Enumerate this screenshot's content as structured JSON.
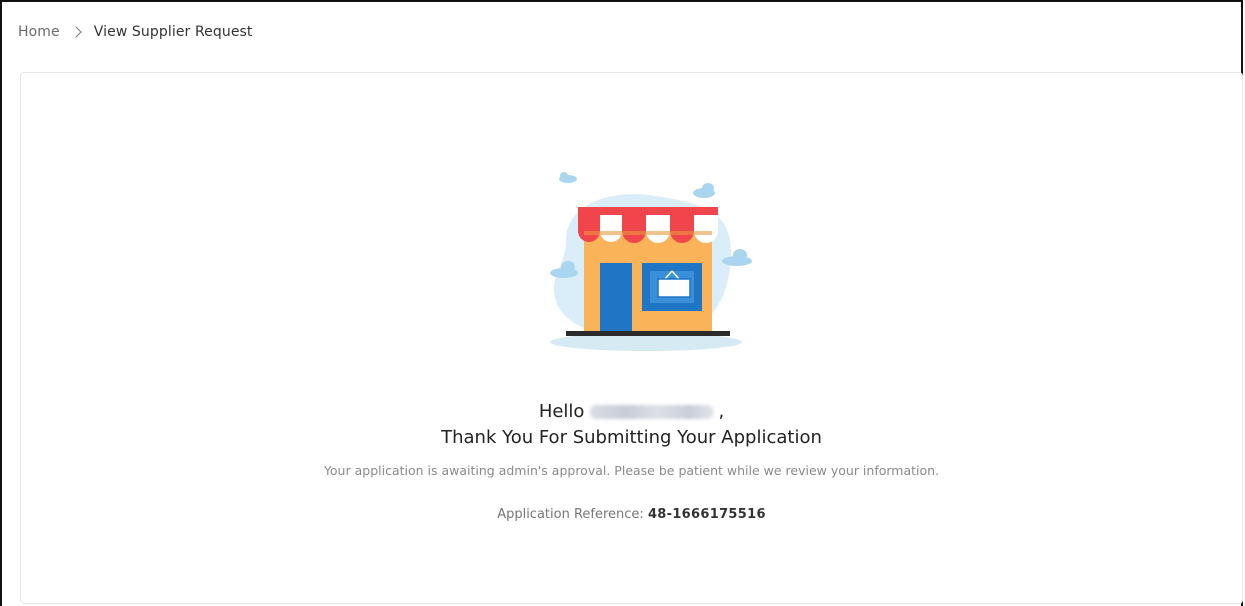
{
  "breadcrumb": {
    "home_label": "Home",
    "separator_icon": "chevron-right-icon",
    "current_label": "View Supplier Request"
  },
  "illustration": {
    "icon": "storefront-illustration",
    "colors": {
      "awning_red": "#f0454a",
      "awning_white": "#ffffff",
      "wall_orange": "#fbb35a",
      "door_blue": "#1f76c5",
      "background_blob": "#d9eef8",
      "cloud": "#a9d6ee",
      "base": "#2b2b2b"
    }
  },
  "message": {
    "greeting_prefix": "Hello",
    "greeting_suffix": ",",
    "title": "Thank You For Submitting Your Application",
    "subtitle": "Your application is awaiting admin's approval. Please be patient while we review your information.",
    "reference_label": "Application Reference:",
    "reference_value": "48-1666175516"
  }
}
